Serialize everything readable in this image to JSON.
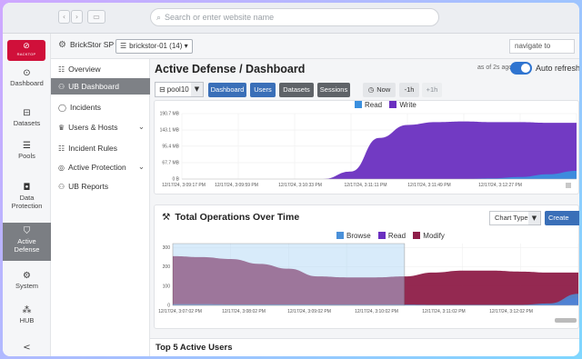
{
  "browser": {
    "search_placeholder": "Search or enter website name",
    "nav_icons": [
      "back-icon",
      "forward-icon",
      "sidebar-icon"
    ]
  },
  "brand": {
    "label": "RACKTOP"
  },
  "rail": [
    {
      "label": "Dashboard",
      "icon": "gauge-icon",
      "glyph": "⊙",
      "active": false
    },
    {
      "label": "Datasets",
      "icon": "database-icon",
      "glyph": "⊟",
      "active": false
    },
    {
      "label": "Pools",
      "icon": "pools-icon",
      "glyph": "☰",
      "active": false
    },
    {
      "label": "Data\nProtection",
      "icon": "camera-icon",
      "glyph": "◘",
      "active": false
    },
    {
      "label": "Active\nDefense",
      "icon": "shield-icon",
      "glyph": "⛉",
      "active": true
    },
    {
      "label": "System",
      "icon": "gear-icon",
      "glyph": "⚙",
      "active": false
    },
    {
      "label": "HUB",
      "icon": "hub-icon",
      "glyph": "⁂",
      "active": false
    }
  ],
  "rail_collapse": "<",
  "topbar": {
    "site": "BrickStor SP",
    "cluster": "brickstor-01 (14) ▾",
    "navigate": "navigate to"
  },
  "menu": [
    {
      "label": "Overview",
      "icon": "list-icon",
      "glyph": "☷",
      "selected": false,
      "caret": false
    },
    {
      "label": "UB Dashboard",
      "icon": "ub-icon",
      "glyph": "⚇",
      "selected": true,
      "caret": false
    },
    {
      "label": "Incidents",
      "icon": "incident-icon",
      "glyph": "◯",
      "selected": false,
      "caret": false
    },
    {
      "label": "Users & Hosts",
      "icon": "users-icon",
      "glyph": "♛",
      "selected": false,
      "caret": true
    },
    {
      "label": "Incident Rules",
      "icon": "rules-icon",
      "glyph": "☷",
      "selected": false,
      "caret": false
    },
    {
      "label": "Active Protection",
      "icon": "protection-icon",
      "glyph": "◎",
      "selected": false,
      "caret": true
    },
    {
      "label": "UB Reports",
      "icon": "reports-icon",
      "glyph": "⚇",
      "selected": false,
      "caret": false
    }
  ],
  "page": {
    "title": "Active Defense / Dashboard",
    "as_of": "as of 2s ago",
    "auto_refresh": "Auto refresh",
    "auto_refresh_on": true
  },
  "toolbar": {
    "pool": "pool10",
    "tabs": [
      "Dashboard",
      "Users",
      "Datasets",
      "Sessions"
    ],
    "now": "Now",
    "h1": "-1h",
    "h1p": "+1h"
  },
  "colors": {
    "read": "#3a8fde",
    "write": "#6a2fc0",
    "browse": "#4a90d9",
    "modify": "#8e1d48",
    "accent": "#3a6fb8"
  },
  "chart2": {
    "title": "Total Operations Over Time",
    "chart_type": "Chart Type",
    "create": "Create Rep"
  },
  "subsection": "Top 5 Active Users",
  "chart_data": [
    {
      "type": "area",
      "title": "",
      "series": [
        {
          "name": "Read",
          "values": [
            0,
            0,
            0,
            0,
            0,
            0,
            0,
            0,
            0,
            0,
            0,
            2,
            6,
            14,
            24
          ]
        },
        {
          "name": "Write",
          "values": [
            0,
            0,
            0,
            0,
            0,
            0,
            22,
            120,
            158,
            166,
            168,
            166,
            166,
            164,
            164
          ]
        }
      ],
      "x": [
        "12/17/24, 3:09:17 PM",
        "",
        "12/17/24, 3:09:59 PM",
        "",
        "12/17/24, 3:10:33 PM",
        "",
        "12/17/24, 3:11:11 PM",
        "",
        "12/17/24, 3:11:49 PM",
        "",
        "12/17/24, 3:12:27 PM",
        "",
        "",
        "",
        ""
      ],
      "x_ticks": [
        "12/17/24, 3:09:17 PM",
        "12/17/24, 3:09:59 PM",
        "12/17/24, 3:10:33 PM",
        "12/17/24, 3:11:11 PM",
        "12/17/24, 3:11:49 PM",
        "12/17/24, 3:12:27 PM"
      ],
      "y_ticks": [
        "0 B",
        "67.7 MB",
        "95.4 MB",
        "143.1 MB",
        "190.7 MB"
      ],
      "y_tick_values": [
        0,
        48,
        96,
        143,
        191
      ],
      "ylim": [
        0,
        191
      ],
      "legend": "top-center",
      "grid": true
    },
    {
      "type": "area",
      "title": "Total Operations Over Time",
      "series": [
        {
          "name": "Browse",
          "values": [
            6,
            6,
            5,
            5,
            5,
            5,
            4,
            4,
            4,
            3,
            3,
            3,
            3,
            10,
            60
          ]
        },
        {
          "name": "Read",
          "values": [
            0,
            0,
            0,
            0,
            0,
            0,
            0,
            0,
            0,
            0,
            0,
            0,
            0,
            5,
            40
          ]
        },
        {
          "name": "Modify",
          "values": [
            255,
            250,
            240,
            215,
            190,
            150,
            145,
            145,
            150,
            170,
            180,
            180,
            175,
            170,
            170
          ]
        }
      ],
      "x_ticks": [
        "12/17/24, 3:07:02 PM",
        "12/17/24, 3:08:02 PM",
        "12/17/24, 3:09:02 PM",
        "12/17/24, 3:10:02 PM",
        "12/17/24, 3:11:02 PM",
        "12/17/24, 3:12:02 PM"
      ],
      "y_ticks": [
        "0",
        "100",
        "200",
        "300"
      ],
      "ylim": [
        0,
        320
      ],
      "legend": "top-center",
      "grid": true
    }
  ]
}
